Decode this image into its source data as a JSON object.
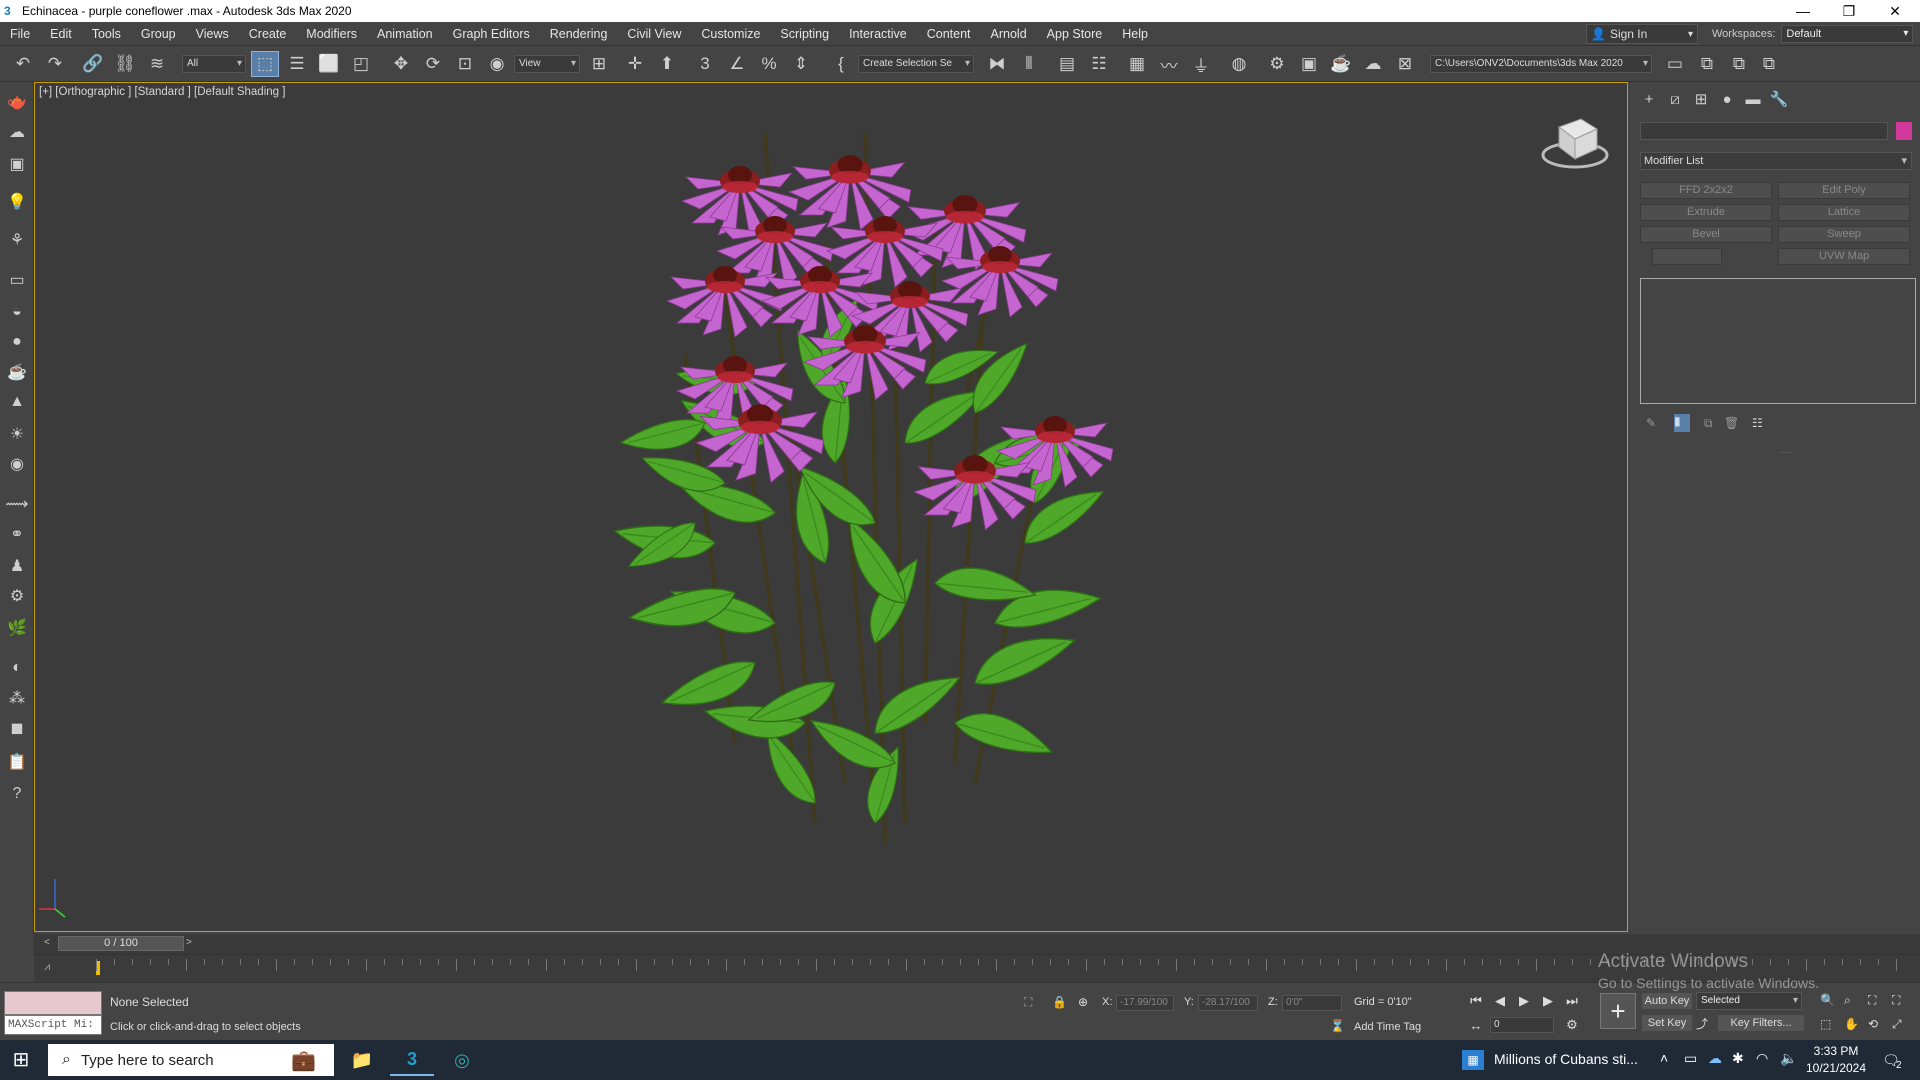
{
  "window": {
    "title": "Echinacea - purple coneflower .max - Autodesk 3ds Max 2020",
    "app_icon": "3"
  },
  "menu": [
    "File",
    "Edit",
    "Tools",
    "Group",
    "Views",
    "Create",
    "Modifiers",
    "Animation",
    "Graph Editors",
    "Rendering",
    "Civil View",
    "Customize",
    "Scripting",
    "Interactive",
    "Content",
    "Arnold",
    "App Store",
    "Help"
  ],
  "signin": {
    "label": "Sign In"
  },
  "workspace": {
    "label": "Workspaces:",
    "value": "Default"
  },
  "toolbar": {
    "filter": "All",
    "refcoord": "View",
    "selection_set": "Create Selection Se",
    "project_path": "C:\\Users\\ONV2\\Documents\\3ds Max 2020"
  },
  "viewport": {
    "label": "[+] [Orthographic ] [Standard ] [Default Shading ]"
  },
  "command_panel": {
    "modifier_list": "Modifier List",
    "buttons": [
      "FFD 2x2x2",
      "Edit Poly",
      "Extrude",
      "Lattice",
      "Bevel",
      "Sweep",
      "",
      "UVW Map"
    ]
  },
  "timeline": {
    "frame": "0 / 100",
    "ticks": [
      "0",
      "5",
      "10",
      "15",
      "20",
      "25",
      "30",
      "35",
      "40",
      "45",
      "50",
      "55",
      "60",
      "65",
      "70",
      "75",
      "80",
      "85",
      "90",
      "95",
      "100"
    ]
  },
  "status": {
    "selection": "None Selected",
    "prompt": "Click or click-and-drag to select objects",
    "maxscript": "MAXScript Mi:",
    "x_label": "X:",
    "x_value": "-17.99/100",
    "y_label": "Y:",
    "y_value": "-28.17/100",
    "z_label": "Z:",
    "z_value": "0'0\"",
    "grid": "Grid = 0'10\"",
    "add_time_tag": "Add Time Tag",
    "auto_key": "Auto Key",
    "set_key": "Set Key",
    "key_mode": "Selected",
    "key_filters": "Key Filters...",
    "frame_field": "0"
  },
  "watermark": {
    "line1": "Activate Windows",
    "line2": "Go to Settings to activate Windows."
  },
  "taskbar": {
    "search_placeholder": "Type here to search",
    "news": "Millions of Cubans sti...",
    "time": "3:33 PM",
    "date": "10/21/2024",
    "notifications": "2"
  },
  "colors": {
    "flower_petal": "#c565cf",
    "flower_center": "#8a1e1e",
    "leaf": "#4fa82a",
    "selection_border": "#c8a000"
  }
}
